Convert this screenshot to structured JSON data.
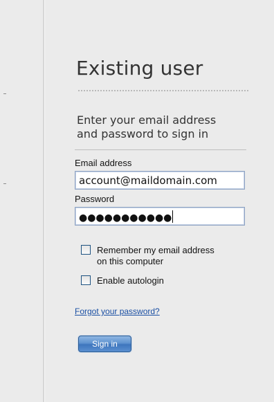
{
  "login": {
    "title": "Existing user",
    "instructions_line1": "Enter your email address",
    "instructions_line2": "and password to sign in",
    "email_label": "Email address",
    "email_value": "account@maildomain.com",
    "password_label": "Password",
    "password_masked": "●●●●●●●●●●●",
    "remember_line1": "Remember my email address",
    "remember_line2": "on this computer",
    "remember_checked": false,
    "autologin_label": "Enable autologin",
    "autologin_checked": false,
    "forgot_link": "Forgot your password?",
    "signin_button": "Sign in"
  },
  "colors": {
    "background": "#ebebeb",
    "link": "#1a4fa3",
    "button": "#3e76bd"
  }
}
